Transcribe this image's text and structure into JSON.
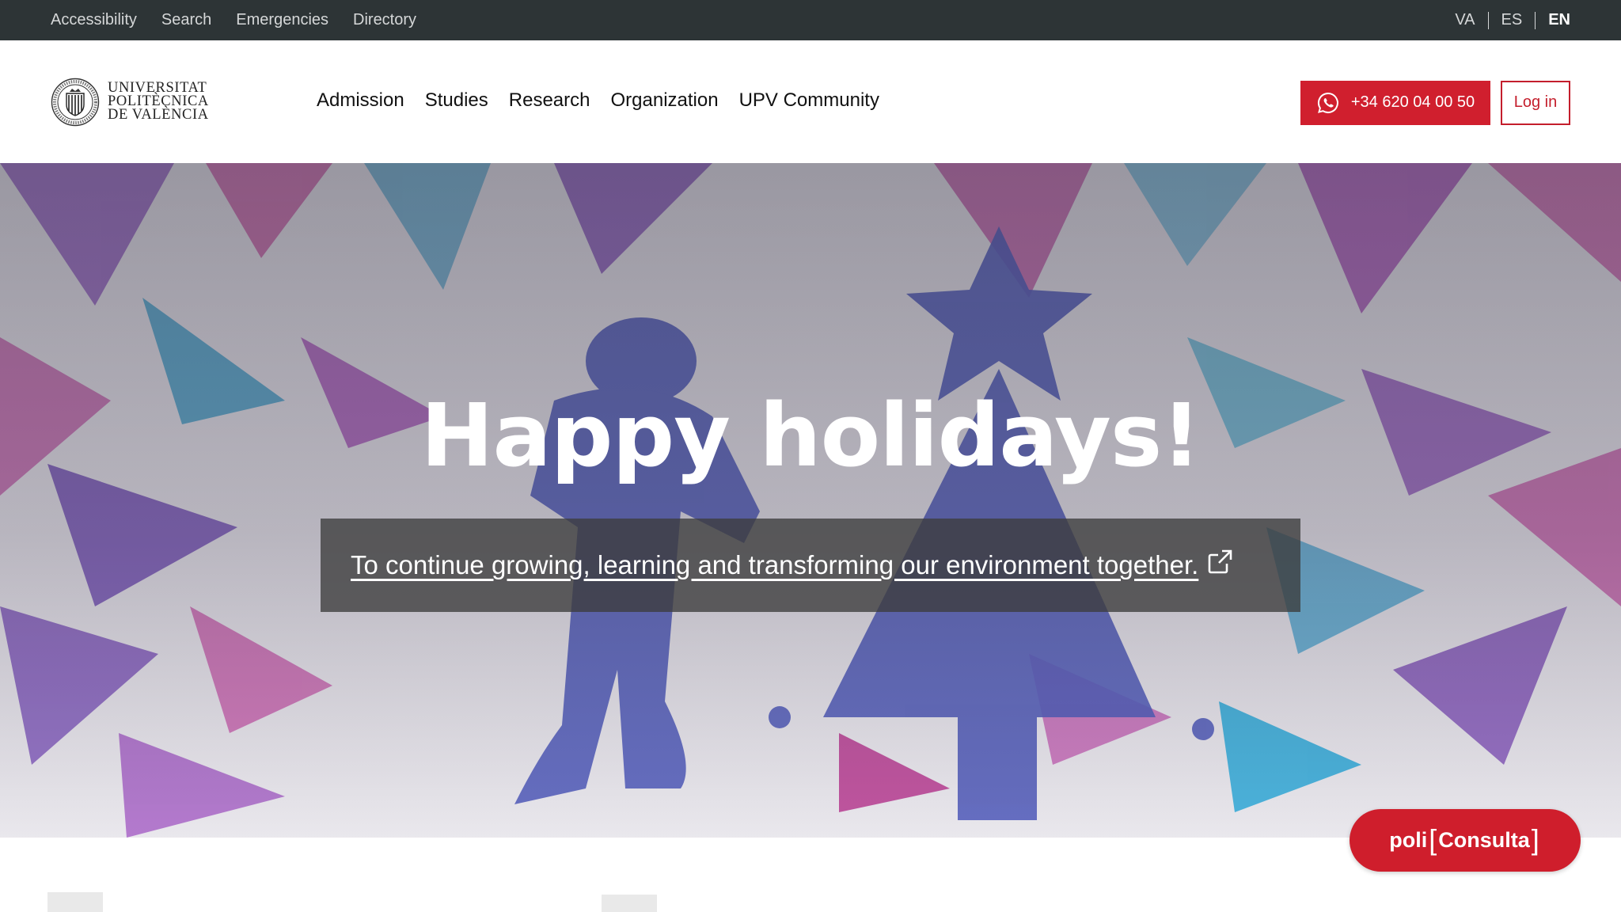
{
  "topbar": {
    "links": [
      "Accessibility",
      "Search",
      "Emergencies",
      "Directory"
    ],
    "languages": [
      "VA",
      "ES",
      "EN"
    ],
    "active_language": "EN"
  },
  "header": {
    "logo_lines": [
      "UNIVERSITAT",
      "POLITÈCNICA",
      "DE VALÈNCIA"
    ],
    "nav": [
      "Admission",
      "Studies",
      "Research",
      "Organization",
      "UPV Community"
    ],
    "phone": "+34 620 04 00 50",
    "phone_icon": "whatsapp-icon",
    "login_label": "Log in"
  },
  "hero": {
    "title": "Happy holidays!",
    "caption": "To continue growing, learning and transforming our environment together.",
    "caption_icon": "external-link-icon"
  },
  "chat": {
    "brand_left": "poli",
    "brand_right": "Consulta"
  },
  "colors": {
    "topbar_bg": "#2d3436",
    "accent_red": "#d01f2e",
    "caption_bg": "#3c3c3c"
  }
}
